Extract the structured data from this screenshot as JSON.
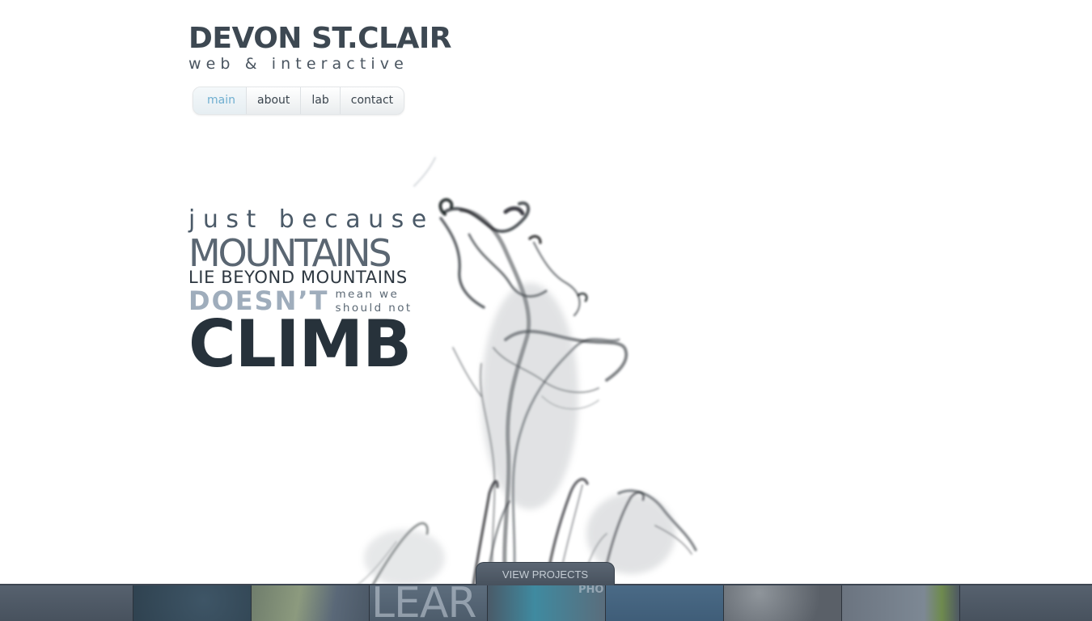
{
  "logo": {
    "name": "DEVON ST.CLAIR",
    "tagline": "web & interactive"
  },
  "nav": {
    "items": [
      {
        "label": "main",
        "active": true
      },
      {
        "label": "about",
        "active": false
      },
      {
        "label": "lab",
        "active": false
      },
      {
        "label": "contact",
        "active": false
      }
    ]
  },
  "quote": {
    "line1": "just because",
    "line2": "MOUNTAINS",
    "line3": "LIE BEYOND MOUNTAINS",
    "line4_big": "DOESN’T",
    "line4_small_a": "mean we",
    "line4_small_b": "should not",
    "line5": "CLIMB"
  },
  "projects": {
    "button_label": "VIEW PROJECTS",
    "thumb_texts": [
      "LEAR",
      "PHO"
    ]
  },
  "colors": {
    "accent": "#6eaed0",
    "strip": "#4a5563",
    "dark_text": "#27323b"
  }
}
